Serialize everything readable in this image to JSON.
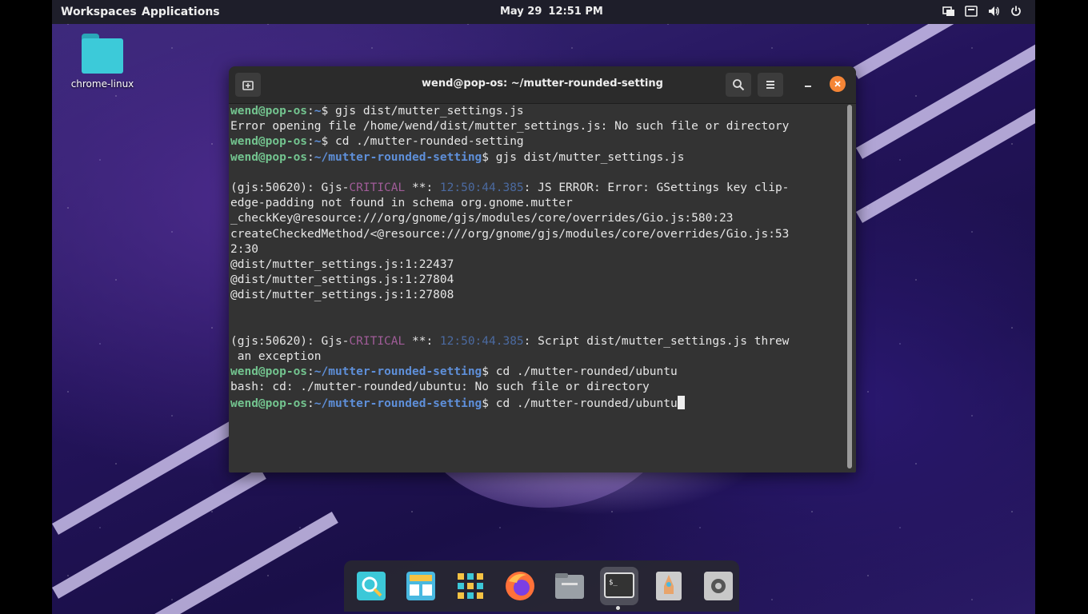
{
  "topbar": {
    "workspaces": "Workspaces",
    "applications": "Applications",
    "date": "May 29",
    "time": "12:51 PM",
    "icons": [
      "display-icon",
      "keyboard-icon",
      "volume-icon",
      "power-icon"
    ]
  },
  "desktop": {
    "icons": [
      {
        "label": "chrome-linux",
        "icon": "folder-icon"
      }
    ]
  },
  "terminal": {
    "title": "wend@pop-os: ~/mutter-rounded-setting",
    "buttons": {
      "new_tab": "new-tab-icon",
      "search": "search-icon",
      "menu": "hamburger-menu-icon",
      "minimize": "minimize-icon",
      "close": "close-icon"
    },
    "prompt_user": "wend@pop-os",
    "lines": [
      {
        "kind": "prompt",
        "path": "~",
        "cmd": "$ gjs dist/mutter_settings.js"
      },
      {
        "kind": "text",
        "text": "Error opening file /home/wend/dist/mutter_settings.js: No such file or directory"
      },
      {
        "kind": "prompt",
        "path": "~",
        "cmd": "$ cd ./mutter-rounded-setting"
      },
      {
        "kind": "prompt",
        "path": "~/mutter-rounded-setting",
        "cmd": "$ gjs dist/mutter_settings.js"
      },
      {
        "kind": "text",
        "text": ""
      },
      {
        "kind": "critical",
        "pre": "(gjs:50620): Gjs-",
        "crit": "CRITICAL",
        "mid": " **: ",
        "ts": "12:50:44.385",
        "post": ": JS ERROR: Error: GSettings key clip-"
      },
      {
        "kind": "text",
        "text": "edge-padding not found in schema org.gnome.mutter"
      },
      {
        "kind": "text",
        "text": "_checkKey@resource:///org/gnome/gjs/modules/core/overrides/Gio.js:580:23"
      },
      {
        "kind": "text",
        "text": "createCheckedMethod/<@resource:///org/gnome/gjs/modules/core/overrides/Gio.js:53"
      },
      {
        "kind": "text",
        "text": "2:30"
      },
      {
        "kind": "text",
        "text": "@dist/mutter_settings.js:1:22437"
      },
      {
        "kind": "text",
        "text": "@dist/mutter_settings.js:1:27804"
      },
      {
        "kind": "text",
        "text": "@dist/mutter_settings.js:1:27808"
      },
      {
        "kind": "text",
        "text": ""
      },
      {
        "kind": "text",
        "text": ""
      },
      {
        "kind": "critical",
        "pre": "(gjs:50620): Gjs-",
        "crit": "CRITICAL",
        "mid": " **: ",
        "ts": "12:50:44.385",
        "post": ": Script dist/mutter_settings.js threw"
      },
      {
        "kind": "text",
        "text": " an exception"
      },
      {
        "kind": "prompt",
        "path": "~/mutter-rounded-setting",
        "cmd": "$ cd ./mutter-rounded/ubuntu"
      },
      {
        "kind": "text",
        "text": "bash: cd: ./mutter-rounded/ubuntu: No such file or directory"
      },
      {
        "kind": "prompt",
        "path": "~/mutter-rounded-setting",
        "cmd": "$ cd ./mutter-rounded/ubuntu",
        "cursor": true
      }
    ]
  },
  "dock": {
    "items": [
      {
        "name": "search-app-icon",
        "color": "#3cc8d8"
      },
      {
        "name": "store-app-icon",
        "color": "#48b8e0"
      },
      {
        "name": "app-grid-icon",
        "color": "#f6c343"
      },
      {
        "name": "firefox-icon",
        "color": "#ff7139"
      },
      {
        "name": "files-icon",
        "color": "#9aa0a6"
      },
      {
        "name": "terminal-icon",
        "color": "#333333",
        "active": true
      },
      {
        "name": "launcher-rocket-icon",
        "color": "#e8a46b"
      },
      {
        "name": "settings-gear-icon",
        "color": "#c8c8c8"
      }
    ]
  }
}
